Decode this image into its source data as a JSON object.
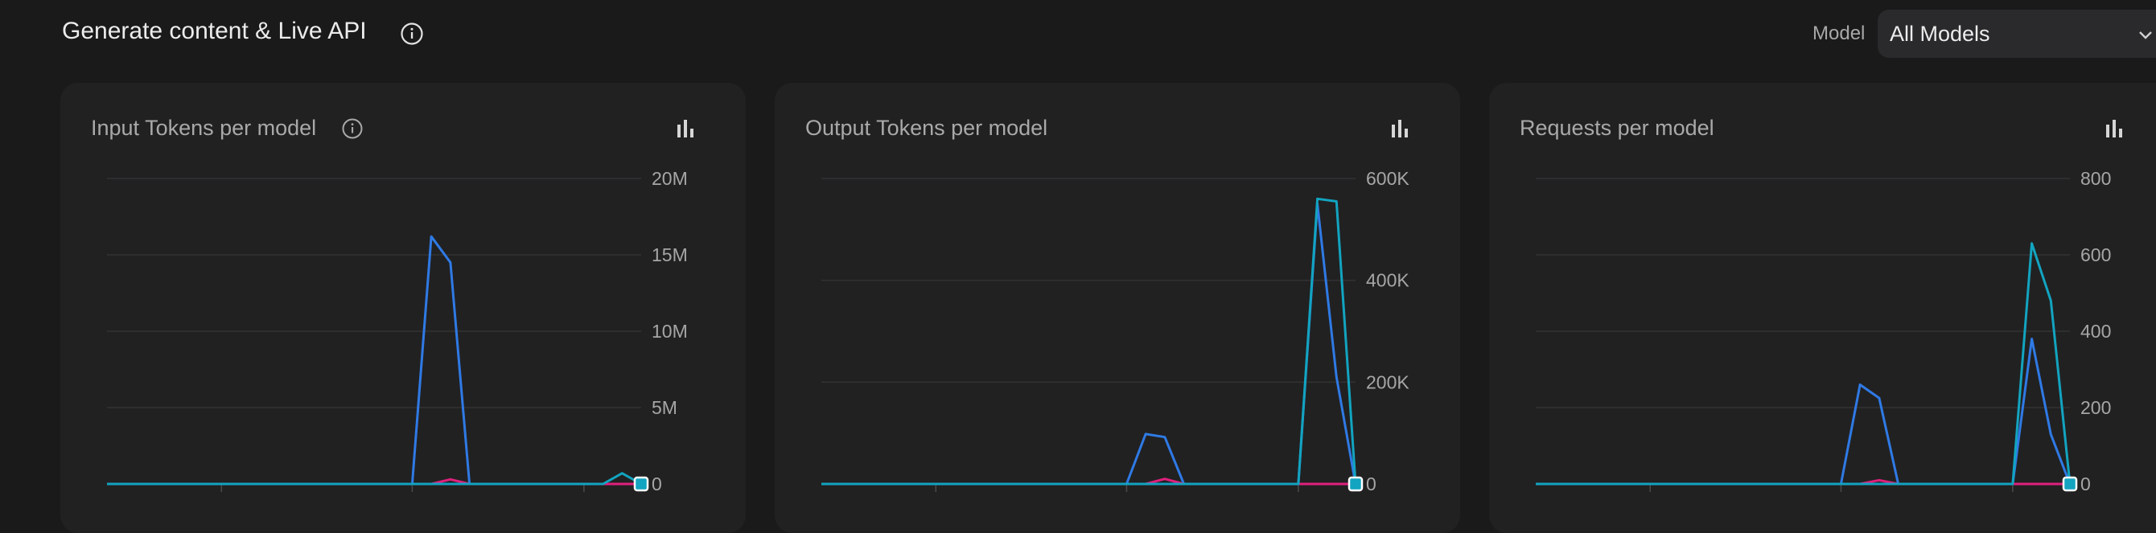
{
  "header": {
    "title": "Generate content & Live API",
    "title_info_icon": "info-circle-icon",
    "model_label": "Model",
    "model_select_value": "All Models",
    "model_select_icon": "chevron-down-icon"
  },
  "colors": {
    "background": "#1a1a1b",
    "card": "#212122",
    "series_blue": "#2f7ae5",
    "series_teal": "#12a4c0",
    "series_pink": "#e0207d",
    "grid": "#333335",
    "tick_text": "#a6a6a6"
  },
  "cards": [
    {
      "title": "Input Tokens per model",
      "has_info": true,
      "info_icon": "info-circle-icon",
      "chart_button_icon": "bar-chart-icon"
    },
    {
      "title": "Output Tokens per model",
      "has_info": false,
      "chart_button_icon": "bar-chart-icon"
    },
    {
      "title": "Requests per model",
      "has_info": false,
      "chart_button_icon": "bar-chart-icon"
    }
  ],
  "chart_data": [
    {
      "type": "line",
      "title": "Input Tokens per model",
      "xlabel": "",
      "ylabel": "",
      "ylim": [
        0,
        20000000
      ],
      "y_ticks": [
        0,
        5000000,
        10000000,
        15000000,
        20000000
      ],
      "y_tick_labels": [
        "0",
        "5M",
        "10M",
        "15M",
        "20M"
      ],
      "y_axis_side": "right",
      "grid": true,
      "x": [
        0,
        1,
        2,
        3,
        4,
        5,
        6,
        7,
        8,
        9,
        10,
        11,
        12,
        13,
        14,
        15,
        16,
        17,
        18,
        19,
        20,
        21,
        22,
        23,
        24,
        25,
        26,
        27,
        28
      ],
      "series": [
        {
          "color": "#2f7ae5",
          "values": [
            0,
            0,
            0,
            0,
            0,
            0,
            0,
            0,
            0,
            0,
            0,
            0,
            0,
            0,
            0,
            0,
            0,
            16200000,
            14500000,
            0,
            0,
            0,
            0,
            0,
            0,
            0,
            0,
            0,
            0
          ]
        },
        {
          "color": "#e0207d",
          "values": [
            0,
            0,
            0,
            0,
            0,
            0,
            0,
            0,
            0,
            0,
            0,
            0,
            0,
            0,
            0,
            0,
            0,
            0,
            300000,
            0,
            0,
            0,
            0,
            0,
            0,
            0,
            0,
            0,
            0
          ]
        },
        {
          "color": "#12a4c0",
          "values": [
            0,
            0,
            0,
            0,
            0,
            0,
            0,
            0,
            0,
            0,
            0,
            0,
            0,
            0,
            0,
            0,
            0,
            0,
            0,
            0,
            0,
            0,
            0,
            0,
            0,
            0,
            0,
            700000,
            0
          ]
        }
      ]
    },
    {
      "type": "line",
      "title": "Output Tokens per model",
      "xlabel": "",
      "ylabel": "",
      "ylim": [
        0,
        600000
      ],
      "y_ticks": [
        0,
        200000,
        400000,
        600000
      ],
      "y_tick_labels": [
        "0",
        "200K",
        "400K",
        "600K"
      ],
      "y_axis_side": "right",
      "grid": true,
      "x": [
        0,
        1,
        2,
        3,
        4,
        5,
        6,
        7,
        8,
        9,
        10,
        11,
        12,
        13,
        14,
        15,
        16,
        17,
        18,
        19,
        20,
        21,
        22,
        23,
        24,
        25,
        26,
        27,
        28
      ],
      "series": [
        {
          "color": "#2f7ae5",
          "values": [
            0,
            0,
            0,
            0,
            0,
            0,
            0,
            0,
            0,
            0,
            0,
            0,
            0,
            0,
            0,
            0,
            0,
            98000,
            92000,
            0,
            0,
            0,
            0,
            0,
            0,
            0,
            550000,
            210000,
            0
          ]
        },
        {
          "color": "#e0207d",
          "values": [
            0,
            0,
            0,
            0,
            0,
            0,
            0,
            0,
            0,
            0,
            0,
            0,
            0,
            0,
            0,
            0,
            0,
            0,
            10000,
            0,
            0,
            0,
            0,
            0,
            0,
            0,
            0,
            0,
            0
          ]
        },
        {
          "color": "#12a4c0",
          "values": [
            0,
            0,
            0,
            0,
            0,
            0,
            0,
            0,
            0,
            0,
            0,
            0,
            0,
            0,
            0,
            0,
            0,
            0,
            0,
            0,
            0,
            0,
            0,
            0,
            0,
            0,
            560000,
            555000,
            0
          ]
        }
      ]
    },
    {
      "type": "line",
      "title": "Requests per model",
      "xlabel": "",
      "ylabel": "",
      "ylim": [
        0,
        800
      ],
      "y_ticks": [
        0,
        200,
        400,
        600,
        800
      ],
      "y_tick_labels": [
        "0",
        "200",
        "400",
        "600",
        "800"
      ],
      "y_axis_side": "right",
      "grid": true,
      "x": [
        0,
        1,
        2,
        3,
        4,
        5,
        6,
        7,
        8,
        9,
        10,
        11,
        12,
        13,
        14,
        15,
        16,
        17,
        18,
        19,
        20,
        21,
        22,
        23,
        24,
        25,
        26,
        27,
        28
      ],
      "series": [
        {
          "color": "#2f7ae5",
          "values": [
            0,
            0,
            0,
            0,
            0,
            0,
            0,
            0,
            0,
            0,
            0,
            0,
            0,
            0,
            0,
            0,
            0,
            260,
            225,
            0,
            0,
            0,
            0,
            0,
            0,
            0,
            380,
            130,
            0
          ]
        },
        {
          "color": "#e0207d",
          "values": [
            0,
            0,
            0,
            0,
            0,
            0,
            0,
            0,
            0,
            0,
            0,
            0,
            0,
            0,
            0,
            0,
            0,
            0,
            10,
            0,
            0,
            0,
            0,
            0,
            0,
            0,
            0,
            0,
            0
          ]
        },
        {
          "color": "#12a4c0",
          "values": [
            0,
            0,
            0,
            0,
            0,
            0,
            0,
            0,
            0,
            0,
            0,
            0,
            0,
            0,
            0,
            0,
            0,
            0,
            0,
            0,
            0,
            0,
            0,
            0,
            0,
            0,
            630,
            480,
            0
          ]
        }
      ]
    }
  ]
}
